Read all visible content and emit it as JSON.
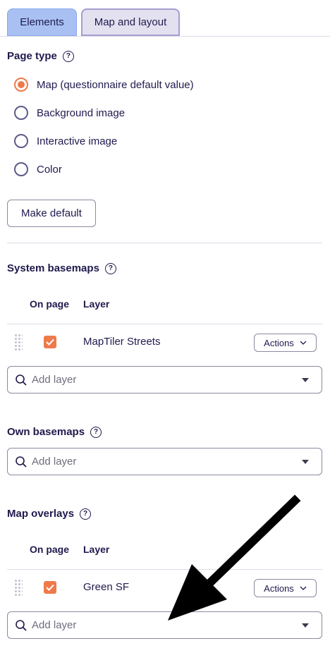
{
  "tabs": [
    {
      "label": "Elements",
      "active": false
    },
    {
      "label": "Map and layout",
      "active": true
    }
  ],
  "page_type": {
    "title": "Page type",
    "options": [
      {
        "label": "Map (questionnaire default value)",
        "checked": true
      },
      {
        "label": "Background image",
        "checked": false
      },
      {
        "label": "Interactive image",
        "checked": false
      },
      {
        "label": "Color",
        "checked": false
      }
    ],
    "make_default_label": "Make default"
  },
  "system_basemaps": {
    "title": "System basemaps",
    "col_on_page": "On page",
    "col_layer": "Layer",
    "rows": [
      {
        "name": "MapTiler Streets",
        "on_page": true,
        "actions_label": "Actions"
      }
    ],
    "add_placeholder": "Add layer"
  },
  "own_basemaps": {
    "title": "Own basemaps",
    "add_placeholder": "Add layer"
  },
  "map_overlays": {
    "title": "Map overlays",
    "col_on_page": "On page",
    "col_layer": "Layer",
    "rows": [
      {
        "name": "Green SF",
        "on_page": true,
        "actions_label": "Actions"
      }
    ],
    "add_placeholder": "Add layer"
  },
  "colors": {
    "accent": "#ee7a4b",
    "text": "#1f1a4d",
    "tab_active_bg": "#e3e1f0",
    "tab_inactive_bg": "#a9c0f3"
  }
}
